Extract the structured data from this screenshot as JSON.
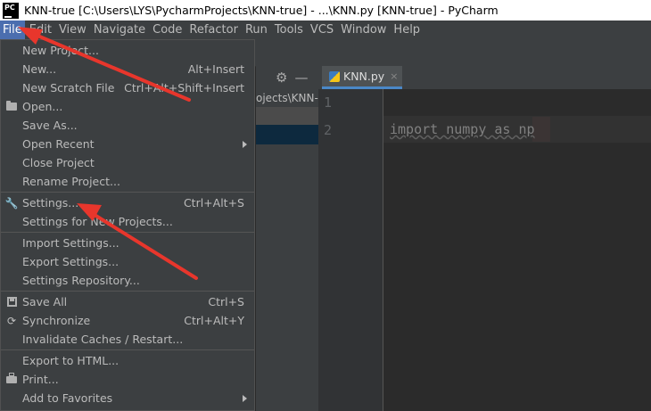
{
  "window": {
    "title": "KNN-true [C:\\Users\\LYS\\PycharmProjects\\KNN-true] - ...\\KNN.py [KNN-true] - PyCharm",
    "logo_text": "PC"
  },
  "menubar": {
    "items": [
      "File",
      "Edit",
      "View",
      "Navigate",
      "Code",
      "Refactor",
      "Run",
      "Tools",
      "VCS",
      "Window",
      "Help"
    ],
    "active_item": "File"
  },
  "project_panel": {
    "breadcrumb": "ojects\\KNN-true",
    "icons": [
      "gear-icon",
      "minus-icon"
    ]
  },
  "editor": {
    "tab_label": "KNN.py",
    "tab_close": "×",
    "line_numbers": [
      "1",
      "2"
    ],
    "code_line": "import numpy as np"
  },
  "file_menu": {
    "items": [
      {
        "label": "New Project...",
        "shortcut": ""
      },
      {
        "label": "New...",
        "shortcut": "Alt+Insert"
      },
      {
        "label": "New Scratch File",
        "shortcut": "Ctrl+Alt+Shift+Insert"
      },
      {
        "label": "Open...",
        "shortcut": "",
        "icon": "folder-icon"
      },
      {
        "label": "Save As...",
        "shortcut": ""
      },
      {
        "label": "Open Recent",
        "shortcut": "",
        "submenu": true
      },
      {
        "label": "Close Project",
        "shortcut": ""
      },
      {
        "label": "Rename Project...",
        "shortcut": ""
      },
      {
        "label": "Settings...",
        "shortcut": "Ctrl+Alt+S",
        "icon": "wrench-icon"
      },
      {
        "label": "Settings for New Projects...",
        "shortcut": ""
      },
      {
        "label": "Import Settings...",
        "shortcut": ""
      },
      {
        "label": "Export Settings...",
        "shortcut": ""
      },
      {
        "label": "Settings Repository...",
        "shortcut": ""
      },
      {
        "label": "Save All",
        "shortcut": "Ctrl+S",
        "icon": "save-icon"
      },
      {
        "label": "Synchronize",
        "shortcut": "Ctrl+Alt+Y",
        "icon": "sync-icon"
      },
      {
        "label": "Invalidate Caches / Restart...",
        "shortcut": ""
      },
      {
        "label": "Export to HTML...",
        "shortcut": ""
      },
      {
        "label": "Print...",
        "shortcut": "",
        "icon": "print-icon"
      },
      {
        "label": "Add to Favorites",
        "shortcut": "",
        "submenu": true
      }
    ]
  },
  "colors": {
    "menu_bg": "#3c3f41",
    "menu_active": "#4b6eaf",
    "editor_bg": "#2b2b2b",
    "annotation_arrow": "#e8362c"
  }
}
